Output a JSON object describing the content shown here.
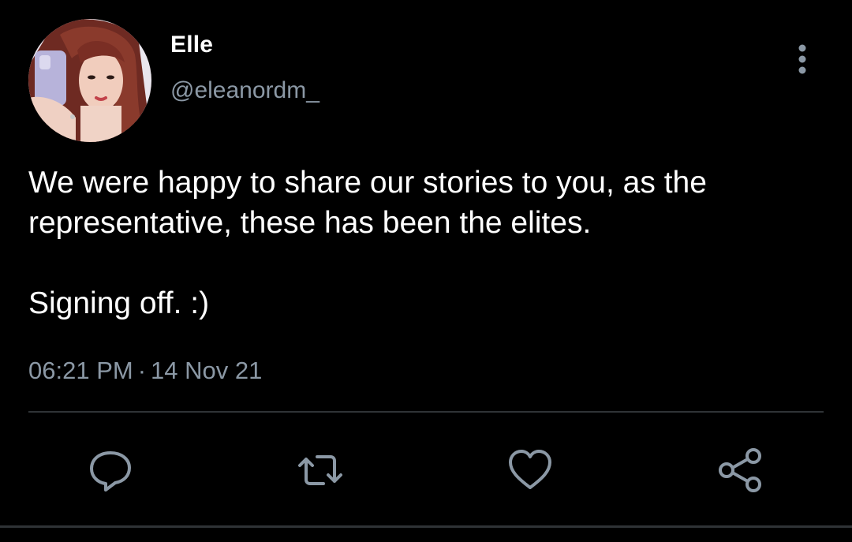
{
  "author": {
    "display_name": "Elle",
    "handle": "@eleanordm_"
  },
  "tweet": {
    "line1": "We were happy to share our stories to you, as the",
    "line2": "representative, these has been the elites.",
    "line3": "Signing off. :)"
  },
  "meta": {
    "time": "06:21 PM",
    "separator": "·",
    "date": "14 Nov 21"
  },
  "actions": [
    {
      "icon": "reply-icon"
    },
    {
      "icon": "retweet-icon"
    },
    {
      "icon": "like-icon"
    },
    {
      "icon": "share-icon"
    }
  ],
  "colors": {
    "background": "#000000",
    "primary_text": "#ffffff",
    "secondary_text": "#8b98a5",
    "divider": "#2f3336"
  }
}
